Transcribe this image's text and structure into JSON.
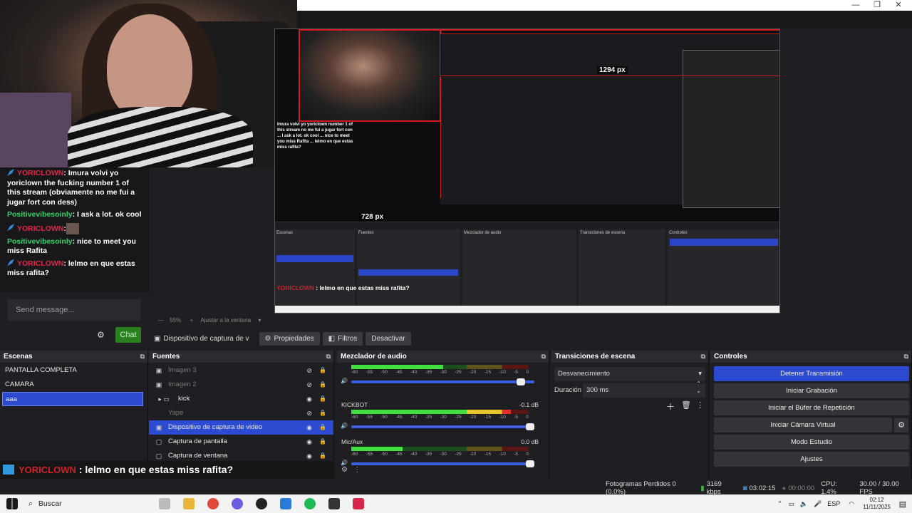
{
  "window": {
    "minimize": "—",
    "restore": "❐",
    "close": "✕"
  },
  "chat": {
    "messages": [
      {
        "user": "YORICLOWN",
        "text": ": Imura volvi yo yoriclown the fucking number 1 of this stream (obviamente no me fui a jugar fort con dess)",
        "style": "u1",
        "badge": true
      },
      {
        "user": "Positivevibesoinly",
        "text": ": I ask a lot. ok cool",
        "style": "u2",
        "badge": false
      },
      {
        "user": "YORICLOWN",
        "text": ":",
        "style": "u1",
        "badge": true,
        "avatar": true
      },
      {
        "user": "Positivevibesoinly",
        "text": ": nice to meet you miss Rafita",
        "style": "u2",
        "badge": false
      },
      {
        "user": "YORICLOWN",
        "text": ": lelmo en que estas miss rafita?",
        "style": "u1",
        "badge": true
      }
    ],
    "placeholder": "Send message...",
    "chat_button": "Chat"
  },
  "preview": {
    "label_1294": "1294 px",
    "label_728": "728 px",
    "caption_user": "YORICLOWN",
    "caption_text": " : lelmo en que estas miss rafita?",
    "mini_chat": "Imura volvi yo yoriclown number 1 of this stream no me fui a jugar fort con ... I ask a lot. ok cool ... nice to meet you miss Rafita ... lelmo en que estas miss rafita?"
  },
  "zoom": {
    "value": "55%",
    "fit": "Ajustar a la ventana"
  },
  "toolbar": {
    "source": "Dispositivo de captura de v",
    "properties": "Propiedades",
    "filters": "Filtros",
    "deactivate": "Desactivar"
  },
  "scenes": {
    "title": "Escenas",
    "items": [
      "PANTALLA COMPLETA",
      "CAMARA",
      "aaa"
    ],
    "selected": 2
  },
  "sources": {
    "title": "Fuentes",
    "items": [
      {
        "name": "Imagen 3",
        "dim": true,
        "icon": "▣",
        "eye": "⊘"
      },
      {
        "name": "Imagen 2",
        "dim": true,
        "icon": "▣",
        "eye": "⊘"
      },
      {
        "name": "kick",
        "dim": false,
        "icon": "▸ ▭",
        "eye": "◉"
      },
      {
        "name": "Yape",
        "dim": true,
        "icon": "",
        "eye": "⊘"
      },
      {
        "name": "Dispositivo de captura de video",
        "dim": false,
        "icon": "▣",
        "eye": "◉",
        "selected": true
      },
      {
        "name": "Captura de pantalla",
        "dim": false,
        "icon": "▢",
        "eye": "◉"
      },
      {
        "name": "Captura de ventana",
        "dim": false,
        "icon": "▢",
        "eye": "◉"
      }
    ]
  },
  "mixer": {
    "title": "Mezclador de audio",
    "ticks": [
      "-60",
      "-55",
      "-50",
      "-45",
      "-40",
      "-35",
      "-30",
      "-25",
      "-20",
      "-15",
      "-10",
      "-5",
      "0"
    ],
    "channels": [
      {
        "name": "",
        "db": "",
        "level": 0.52,
        "volume": 0.95
      },
      {
        "name": "KICKBOT",
        "db": "-0.1 dB",
        "level": 0.9,
        "volume": 1.0
      },
      {
        "name": "Mic/Aux",
        "db": "0.0 dB",
        "level": 0.29,
        "volume": 1.0
      }
    ]
  },
  "transitions": {
    "title": "Transiciones de escena",
    "selected": "Desvanecimiento",
    "duration_label": "Duración",
    "duration": "300 ms"
  },
  "controls": {
    "title": "Controles",
    "buttons": [
      "Detener Transmisión",
      "Iniciar Grabación",
      "Iniciar el Búfer de Repetición",
      "Iniciar Cámara Virtual",
      "Modo Estudio",
      "Ajustes"
    ]
  },
  "caption": {
    "user": "YORICLOWN",
    "text": " : lelmo en que estas miss rafita?"
  },
  "status": {
    "dropped": "Fotogramas Perdidos 0 (0.0%)",
    "bitrate": "3169 kbps",
    "stream_time": "03:02:15",
    "rec_time": "00:00:00",
    "cpu": "CPU: 1.4%",
    "fps": "30.00 / 30.00 FPS"
  },
  "taskbar": {
    "search": "Buscar",
    "lang": "ESP",
    "time": "02:12",
    "date": "11/11/2025"
  },
  "colors": {
    "accent": "#2c4bd0",
    "chat_button": "#2a7f21",
    "username": "#e0284a",
    "username2": "#36d36c"
  }
}
